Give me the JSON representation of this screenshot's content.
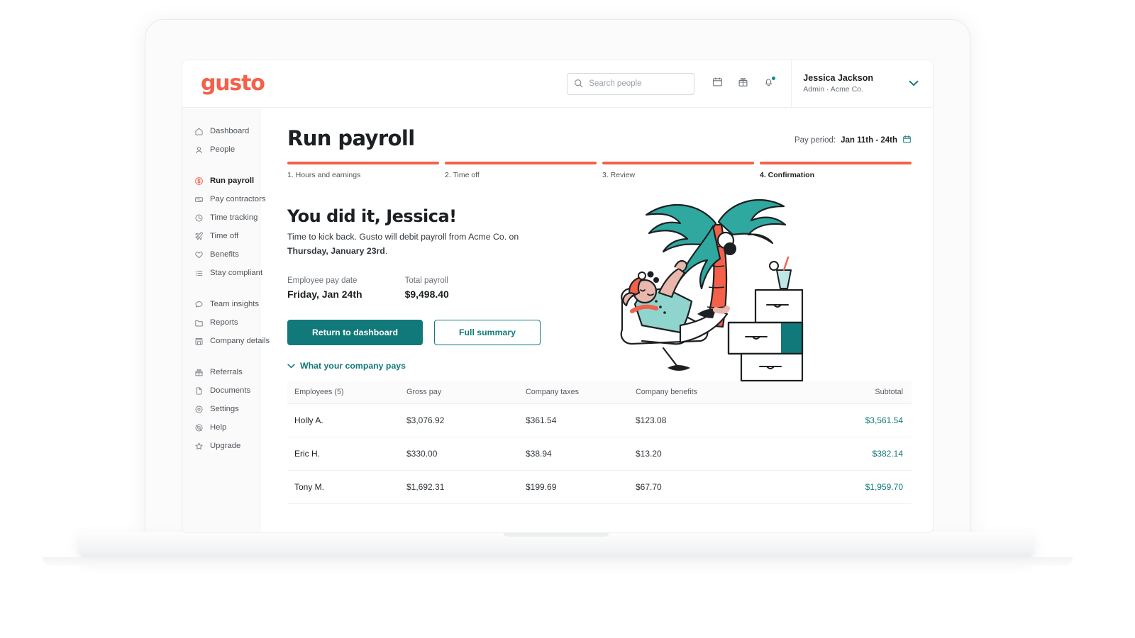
{
  "brand": {
    "logo_text": "gusto",
    "coral": "#f4604a",
    "teal": "#12797a"
  },
  "topbar": {
    "search": {
      "placeholder": "Search people",
      "value": "",
      "icon": "search-icon"
    },
    "icons": [
      {
        "name": "calendar-icon",
        "label": "Calendar"
      },
      {
        "name": "gift-icon",
        "label": "Gift"
      },
      {
        "name": "bell-icon",
        "label": "Notifications",
        "has_badge": true
      }
    ],
    "user": {
      "name": "Jessica Jackson",
      "subtitle": "Admin · Acme Co.",
      "chevron": "chevron-down-icon"
    }
  },
  "sidebar": {
    "groups": [
      {
        "items": [
          {
            "label": "Dashboard",
            "icon": "home-icon",
            "active": false
          },
          {
            "label": "People",
            "icon": "people-icon",
            "active": false
          }
        ]
      },
      {
        "items": [
          {
            "label": "Run payroll",
            "icon": "dollar-coin-icon",
            "active": true
          },
          {
            "label": "Pay contractors",
            "icon": "money-icon",
            "active": false
          },
          {
            "label": "Time tracking",
            "icon": "clock-icon",
            "active": false
          },
          {
            "label": "Time off",
            "icon": "plane-icon",
            "active": false
          },
          {
            "label": "Benefits",
            "icon": "heart-icon",
            "active": false
          },
          {
            "label": "Stay compliant",
            "icon": "list-icon",
            "active": false
          }
        ]
      },
      {
        "items": [
          {
            "label": "Team insights",
            "icon": "chat-bubble-icon",
            "active": false
          },
          {
            "label": "Reports",
            "icon": "folder-icon",
            "active": false
          },
          {
            "label": "Company details",
            "icon": "building-icon",
            "active": false
          }
        ]
      },
      {
        "items": [
          {
            "label": "Referrals",
            "icon": "gift-icon",
            "active": false
          },
          {
            "label": "Documents",
            "icon": "document-icon",
            "active": false
          },
          {
            "label": "Settings",
            "icon": "gear-icon",
            "active": false
          },
          {
            "label": "Help",
            "icon": "help-icon",
            "active": false
          },
          {
            "label": "Upgrade",
            "icon": "star-icon",
            "active": false
          }
        ]
      }
    ]
  },
  "main": {
    "page_title": "Run payroll",
    "pay_period": {
      "label": "Pay period:",
      "value": "Jan 11th - 24th",
      "icon": "calendar-icon"
    },
    "steps": [
      {
        "label": "1. Hours and earnings",
        "current": false
      },
      {
        "label": "2. Time off",
        "current": false
      },
      {
        "label": "3. Review",
        "current": false
      },
      {
        "label": "4. Confirmation",
        "current": true
      }
    ],
    "hero": {
      "title": "You did it, Jessica!",
      "sub_part1": "Time to kick back. Gusto will debit payroll from Acme Co. on ",
      "sub_bold": "Thursday, January 23rd",
      "sub_part2": ".",
      "facts": [
        {
          "label": "Employee pay date",
          "value": "Friday, Jan 24th"
        },
        {
          "label": "Total payroll",
          "value": "$9,498.40"
        }
      ],
      "primary_button": "Return to dashboard",
      "secondary_button": "Full summary",
      "illustration": "person-relaxing-palm-tree-illustration"
    },
    "disclosure": {
      "label": "What your company pays",
      "icon": "chevron-down-icon",
      "expanded": true
    },
    "table": {
      "columns": [
        "Employees (5)",
        "Gross pay",
        "Company taxes",
        "Company benefits",
        "Subtotal"
      ],
      "rows": [
        {
          "employee": "Holly A.",
          "gross_pay": "$3,076.92",
          "company_taxes": "$361.54",
          "company_benefits": "$123.08",
          "subtotal": "$3,561.54"
        },
        {
          "employee": "Eric H.",
          "gross_pay": "$330.00",
          "company_taxes": "$38.94",
          "company_benefits": "$13.20",
          "subtotal": "$382.14"
        },
        {
          "employee": "Tony M.",
          "gross_pay": "$1,692.31",
          "company_taxes": "$199.69",
          "company_benefits": "$67.70",
          "subtotal": "$1,959.70"
        }
      ]
    }
  }
}
